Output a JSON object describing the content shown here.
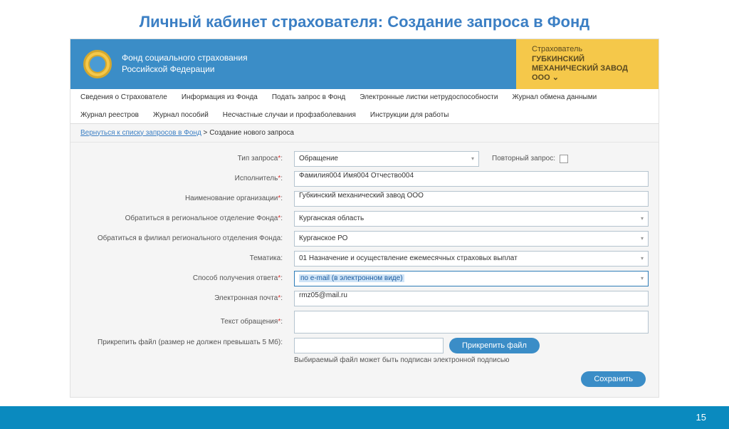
{
  "slide_title": "Личный кабинет страхователя: Создание запроса в Фонд",
  "header": {
    "org_line1": "Фонд социального страхования",
    "org_line2": "Российской Федерации",
    "role_label": "Страхователь",
    "company": "ГУБКИНСКИЙ МЕХАНИЧЕСКИЙ ЗАВОД ООО"
  },
  "nav": {
    "items": [
      "Сведения о Страхователе",
      "Информация из Фонда",
      "Подать запрос в Фонд",
      "Электронные листки нетрудоспособности",
      "Журнал обмена данными",
      "Журнал реестров",
      "Журнал пособий",
      "Несчастные случаи и профзаболевания",
      "Инструкции для работы"
    ]
  },
  "breadcrumb": {
    "link": "Вернуться к списку запросов в Фонд",
    "current": "Создание нового запроса"
  },
  "form": {
    "type_label": "Тип запроса",
    "type_value": "Обращение",
    "repeat_label": "Повторный запрос:",
    "executor_label": "Исполнитель",
    "executor_value": "Фамилия004 Имя004 Отчество004",
    "org_label": "Наименование организации",
    "org_value": "Губкинский механический завод ООО",
    "region_label": "Обратиться в региональное отделение Фонда",
    "region_value": "Курганская область",
    "branch_label": "Обратиться в филиал регионального отделения Фонда:",
    "branch_value": "Курганское РО",
    "topic_label": "Тематика:",
    "topic_value": "01   Назначение и осуществление ежемесячных страховых выплат",
    "method_label": "Способ получения ответа",
    "method_value": "по e-mail (в электронном виде)",
    "email_label": "Электронная почта",
    "email_value": "rmz05@mail.ru",
    "text_label": "Текст обращения",
    "file_label": "Прикрепить файл (размер не должен превышать 5 Мб):",
    "attach_btn": "Прикрепить файл",
    "file_note": "Выбираемый файл может быть подписан электронной подписью",
    "save_btn": "Сохранить"
  },
  "page_number": "15"
}
